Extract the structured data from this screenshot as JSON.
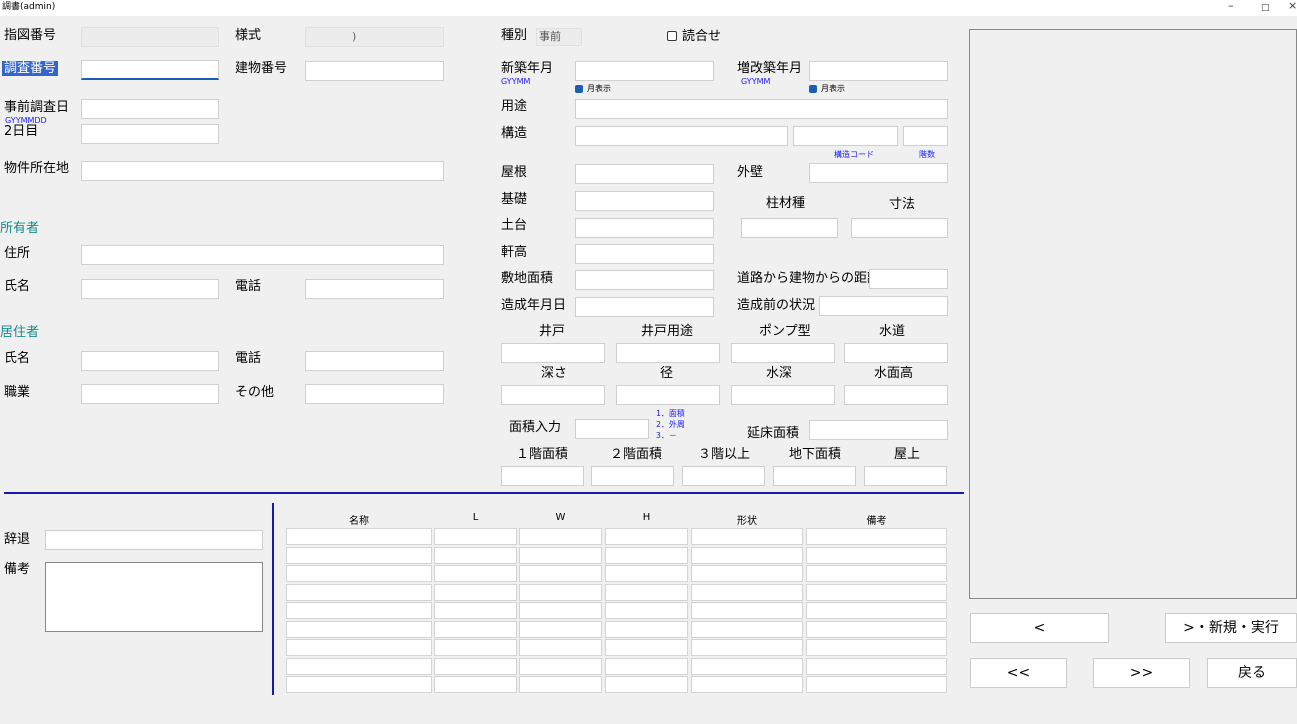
{
  "window": {
    "title": "調書(admin)",
    "minimize": "–",
    "maximize": "□",
    "close": "×"
  },
  "left": {
    "shizu_label": "指図番号",
    "yoshiki_label": "様式",
    "yoshiki_value": "　　　　)",
    "chosa_label": "調査番号",
    "tatemono_label": "建物番号",
    "jizen_label": "事前調査日",
    "jizen_hint": "GYYMMDD",
    "day2_label": "2日目",
    "address_label": "物件所在地",
    "owner_header": "所有者",
    "owner_addr_label": "住所",
    "owner_name_label": "氏名",
    "owner_tel_label": "電話",
    "resident_header": "居住者",
    "res_name_label": "氏名",
    "res_tel_label": "電話",
    "job_label": "職業",
    "other_label": "その他"
  },
  "mid": {
    "shubetsu_label": "種別",
    "shubetsu_value": "事前",
    "yomiawase_label": "読合せ",
    "shinchiku_label": "新築年月",
    "shinchiku_hint": "GYYMM",
    "month_label1": "月表示",
    "zokai_label": "増改築年月",
    "zokai_hint": "GYYMM",
    "month_label2": "月表示",
    "yoto_label": "用途",
    "kozo_label": "構造",
    "kozo_code": "構造コード",
    "kaisu": "階数",
    "yane": "屋根",
    "gaiheki": "外壁",
    "kiso": "基礎",
    "hashira": "柱材種",
    "sunpo": "寸法",
    "dodai": "土台",
    "nokidaka": "軒高",
    "shikichi": "敷地面積",
    "doro": "道路から建物からの距離",
    "zosei_date": "造成年月日",
    "zosei_before": "造成前の状況",
    "ido": "井戸",
    "ido_yoto": "井戸用途",
    "pump": "ポンプ型",
    "suido": "水道",
    "fukasa": "深さ",
    "kei": "径",
    "suishin": "水深",
    "suimen": "水面高",
    "menseki_input": "面積入力",
    "opt1": "1．面積",
    "opt2": "2．外周",
    "opt3": "3．－",
    "nobeyuka": "延床面積",
    "f1": "１階面積",
    "f2": "２階面積",
    "f3": "３階以上",
    "basement": "地下面積",
    "roof": "屋上"
  },
  "bottom": {
    "jitai": "辞退",
    "biko": "備考",
    "table_headers": [
      "名称",
      "L",
      "W",
      "H",
      "形状",
      "備考"
    ]
  },
  "buttons": {
    "prev": "<",
    "next_new": ">・新規・実行",
    "first": "<<",
    "last": ">>",
    "back": "戻る"
  }
}
